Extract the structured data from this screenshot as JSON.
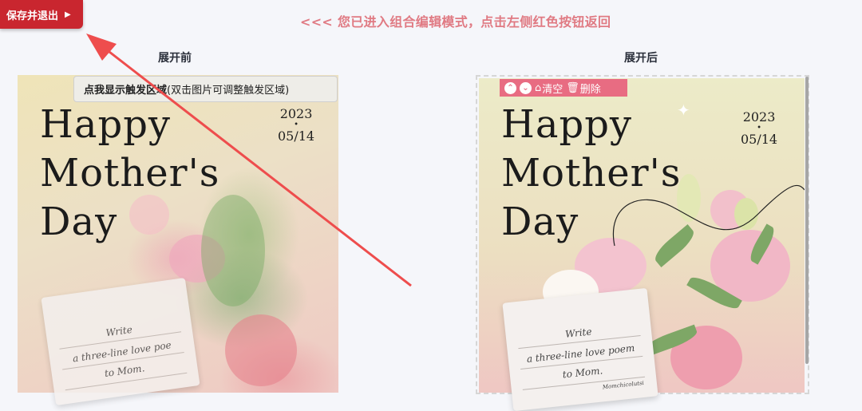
{
  "header": {
    "exit_label": "保存并退出",
    "mode_tip": "<<< 您已进入组合编辑模式，点击左侧红色按钮返回"
  },
  "columns": {
    "before_title": "展开前",
    "after_title": "展开后"
  },
  "before": {
    "hint_bold": "点我显示触发区域",
    "hint_rest": "(双击图片可调整触发区域)"
  },
  "after": {
    "toolbar": {
      "clear_label": "清空",
      "delete_label": "删除"
    }
  },
  "poster": {
    "headline_1": "Happy",
    "headline_2": "Mother's",
    "headline_3": "Day",
    "year": "2023",
    "date": "05/14",
    "card_line_1": "Write",
    "card_line_2_before": "a three-line love poe",
    "card_line_2_after": "a three-line love poem",
    "card_line_3": "to Mom.",
    "card_signature": "Momchicolutsi"
  },
  "colors": {
    "exit_button": "#c9262f",
    "tip_text": "#e07a83",
    "toolbar": "#e86c82",
    "arrow": "#ee4d4d"
  }
}
